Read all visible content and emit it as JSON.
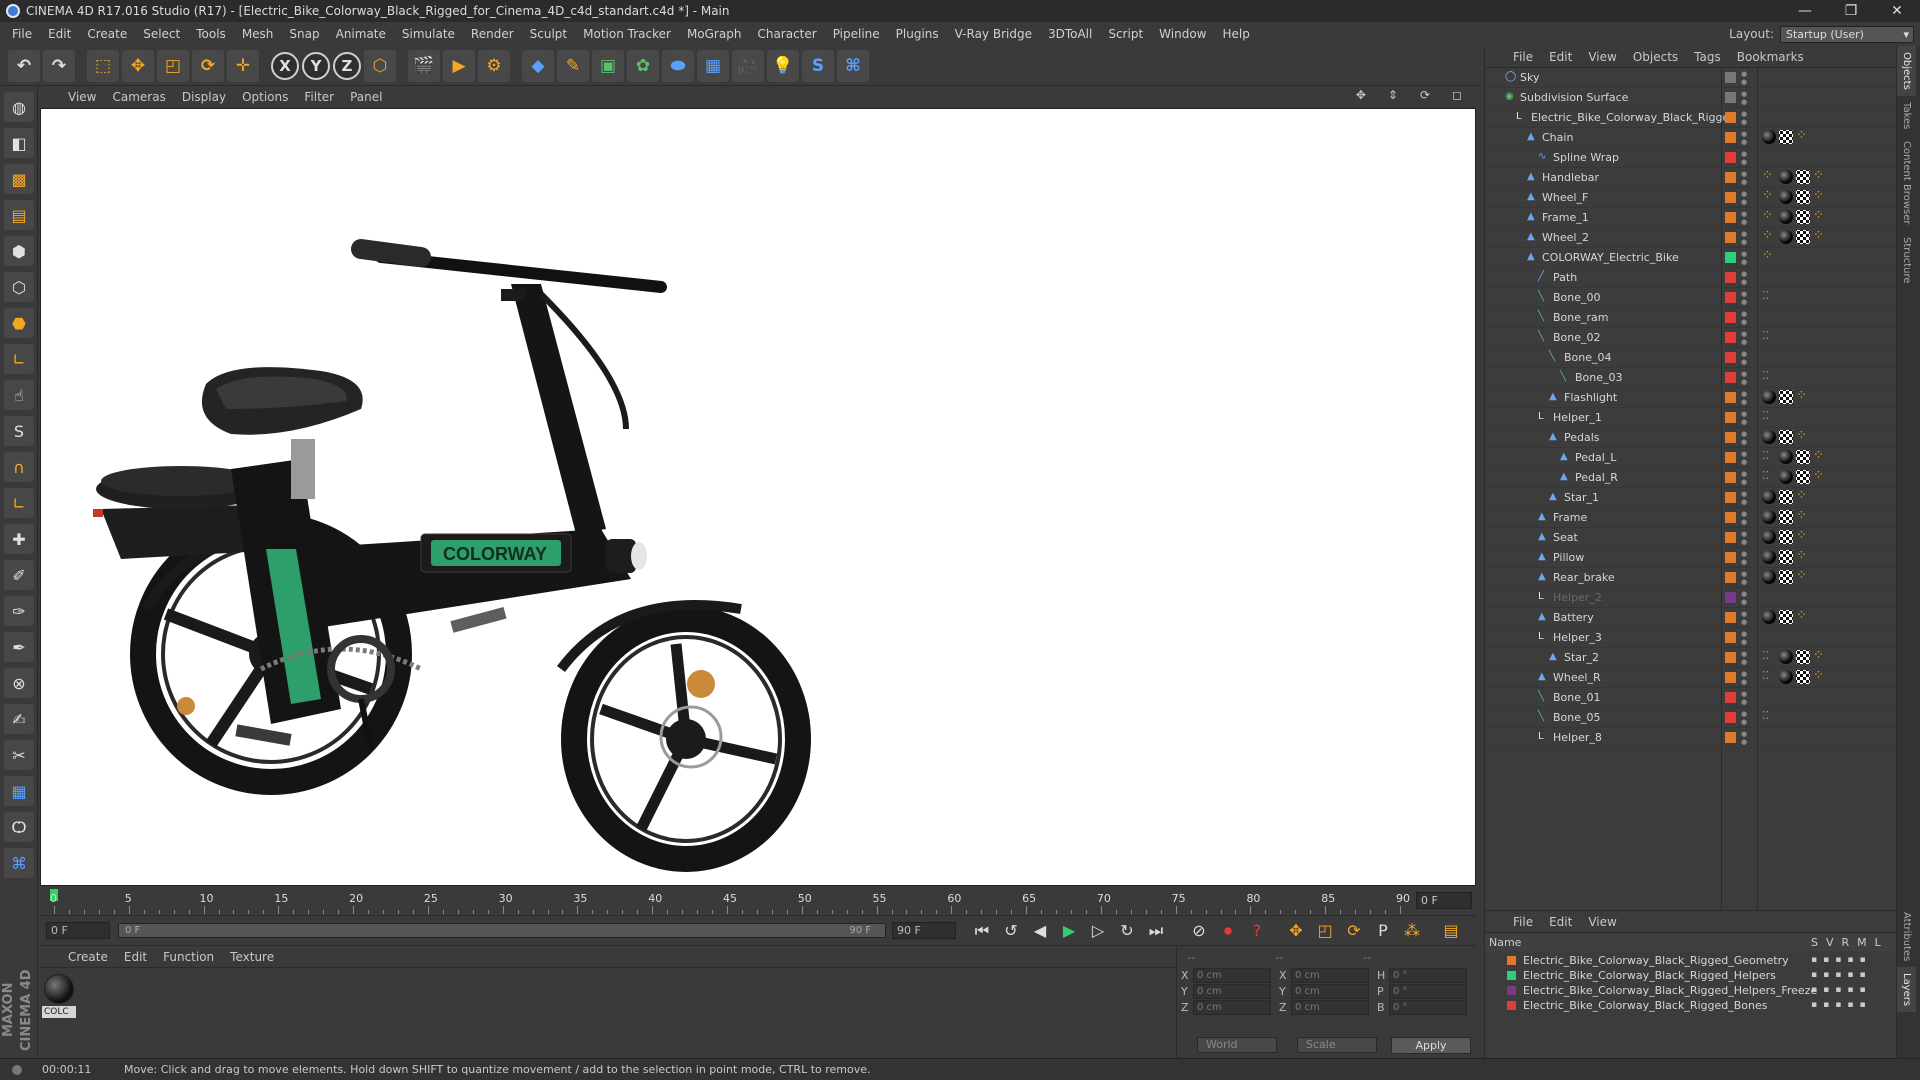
{
  "window": {
    "title": "CINEMA 4D R17.016 Studio (R17) - [Electric_Bike_Colorway_Black_Rigged_for_Cinema_4D_c4d_standart.c4d *] - Main",
    "controls": [
      "—",
      "❐",
      "✕"
    ]
  },
  "menubar": [
    "File",
    "Edit",
    "Create",
    "Select",
    "Tools",
    "Mesh",
    "Snap",
    "Animate",
    "Simulate",
    "Render",
    "Sculpt",
    "Motion Tracker",
    "MoGraph",
    "Character",
    "Pipeline",
    "Plugins",
    "V-Ray Bridge",
    "3DToAll",
    "Script",
    "Window",
    "Help"
  ],
  "layout": {
    "label": "Layout:",
    "value": "Startup (User)"
  },
  "viewport": {
    "menu": [
      "View",
      "Cameras",
      "Display",
      "Options",
      "Filter",
      "Panel"
    ],
    "nav_icons": [
      "✥",
      "⇕",
      "⟳",
      "◻"
    ],
    "logo_text": "COLORWAY"
  },
  "timeline": {
    "ticks": [
      "0",
      "5",
      "10",
      "15",
      "20",
      "25",
      "30",
      "35",
      "40",
      "45",
      "50",
      "55",
      "60",
      "65",
      "70",
      "75",
      "80",
      "85",
      "90"
    ],
    "end_frame": "0 F"
  },
  "transport": {
    "current_frame": "0 F",
    "range_start": "0 F",
    "range_end": "90 F",
    "max_frame": "90 F"
  },
  "material_manager": {
    "menu": [
      "Create",
      "Edit",
      "Function",
      "Texture"
    ],
    "material_label": "COLC"
  },
  "coordinates": {
    "rows": [
      {
        "a": "X",
        "av": "0 cm",
        "b": "X",
        "bv": "0 cm",
        "c": "H",
        "cv": "0 °"
      },
      {
        "a": "Y",
        "av": "0 cm",
        "b": "Y",
        "bv": "0 cm",
        "c": "P",
        "cv": "0 °"
      },
      {
        "a": "Z",
        "av": "0 cm",
        "b": "Z",
        "bv": "0 cm",
        "c": "B",
        "cv": "0 °"
      }
    ],
    "top_labels": [
      "--",
      "--",
      "--"
    ],
    "mode": "World",
    "scale_mode": "Scale",
    "apply": "Apply"
  },
  "object_manager": {
    "menu": [
      "File",
      "Edit",
      "View",
      "Objects",
      "Tags",
      "Bookmarks"
    ],
    "objects": [
      {
        "name": "Sky",
        "indent": 0,
        "icon": "sky-icon",
        "layer": "#777777",
        "tags": []
      },
      {
        "name": "Subdivision Surface",
        "indent": 0,
        "icon": "subdivision-icon",
        "layer": "#777777",
        "tags": []
      },
      {
        "name": "Electric_Bike_Colorway_Black_Rigged",
        "indent": 1,
        "icon": "null-icon",
        "layer": "#e07a2a",
        "tags": []
      },
      {
        "name": "Chain",
        "indent": 2,
        "icon": "polygon-icon",
        "layer": "#e07a2a",
        "tags": [
          "mat",
          "chk",
          "orn"
        ]
      },
      {
        "name": "Spline Wrap",
        "indent": 3,
        "icon": "deformer-icon",
        "layer": "#e33a3a",
        "tags": []
      },
      {
        "name": "Handlebar",
        "indent": 2,
        "icon": "polygon-icon",
        "layer": "#e07a2a",
        "tags": [
          "orn",
          "mat",
          "chk",
          "orn"
        ]
      },
      {
        "name": "Wheel_F",
        "indent": 2,
        "icon": "polygon-icon",
        "layer": "#e07a2a",
        "tags": [
          "orn",
          "mat",
          "chk",
          "orn"
        ]
      },
      {
        "name": "Frame_1",
        "indent": 2,
        "icon": "polygon-icon",
        "layer": "#e07a2a",
        "tags": [
          "orn",
          "mat",
          "chk",
          "orn"
        ]
      },
      {
        "name": "Wheel_2",
        "indent": 2,
        "icon": "polygon-icon",
        "layer": "#e07a2a",
        "tags": [
          "orn",
          "mat",
          "chk",
          "orn"
        ]
      },
      {
        "name": "COLORWAY_Electric_Bike",
        "indent": 2,
        "icon": "polygon-icon",
        "layer": "#2fcf7a",
        "tags": [
          "orn"
        ]
      },
      {
        "name": "Path",
        "indent": 3,
        "icon": "spline-icon",
        "layer": "#e33a3a",
        "tags": []
      },
      {
        "name": "Bone_00",
        "indent": 3,
        "icon": "bone-icon",
        "layer": "#e33a3a",
        "tags": [
          "blu"
        ]
      },
      {
        "name": "Bone_ram",
        "indent": 3,
        "icon": "bone-icon",
        "layer": "#e33a3a",
        "tags": []
      },
      {
        "name": "Bone_02",
        "indent": 3,
        "icon": "bone-icon",
        "layer": "#e33a3a",
        "tags": [
          "blu"
        ]
      },
      {
        "name": "Bone_04",
        "indent": 4,
        "icon": "bone-icon",
        "layer": "#e33a3a",
        "tags": []
      },
      {
        "name": "Bone_03",
        "indent": 5,
        "icon": "bone-icon",
        "layer": "#e33a3a",
        "tags": [
          "blu"
        ]
      },
      {
        "name": "Flashlight",
        "indent": 4,
        "icon": "polygon-icon",
        "layer": "#e07a2a",
        "tags": [
          "mat",
          "chk",
          "orn"
        ]
      },
      {
        "name": "Helper_1",
        "indent": 3,
        "icon": "null-icon",
        "layer": "#e07a2a",
        "tags": [
          "blu"
        ]
      },
      {
        "name": "Pedals",
        "indent": 4,
        "icon": "polygon-icon",
        "layer": "#e07a2a",
        "tags": [
          "mat",
          "chk",
          "orn"
        ]
      },
      {
        "name": "Pedal_L",
        "indent": 5,
        "icon": "polygon-icon",
        "layer": "#e07a2a",
        "tags": [
          "blu",
          "mat",
          "chk",
          "orn"
        ]
      },
      {
        "name": "Pedal_R",
        "indent": 5,
        "icon": "polygon-icon",
        "layer": "#e07a2a",
        "tags": [
          "blu",
          "mat",
          "chk",
          "orn"
        ]
      },
      {
        "name": "Star_1",
        "indent": 4,
        "icon": "polygon-icon",
        "layer": "#e07a2a",
        "tags": [
          "mat",
          "chk",
          "orn"
        ]
      },
      {
        "name": "Frame",
        "indent": 3,
        "icon": "polygon-icon",
        "layer": "#e07a2a",
        "tags": [
          "mat",
          "chk",
          "orn"
        ]
      },
      {
        "name": "Seat",
        "indent": 3,
        "icon": "polygon-icon",
        "layer": "#e07a2a",
        "tags": [
          "mat",
          "chk",
          "orn"
        ]
      },
      {
        "name": "Pillow",
        "indent": 3,
        "icon": "polygon-icon",
        "layer": "#e07a2a",
        "tags": [
          "mat",
          "chk",
          "orn"
        ]
      },
      {
        "name": "Rear_brake",
        "indent": 3,
        "icon": "polygon-icon",
        "layer": "#e07a2a",
        "tags": [
          "mat",
          "chk",
          "orn"
        ]
      },
      {
        "name": "Helper_2",
        "indent": 3,
        "icon": "null-icon",
        "layer": "#7a3a8a",
        "tags": [],
        "dim": true
      },
      {
        "name": "Battery",
        "indent": 3,
        "icon": "polygon-icon",
        "layer": "#e07a2a",
        "tags": [
          "mat",
          "chk",
          "orn"
        ]
      },
      {
        "name": "Helper_3",
        "indent": 3,
        "icon": "null-icon",
        "layer": "#e07a2a",
        "tags": []
      },
      {
        "name": "Star_2",
        "indent": 4,
        "icon": "polygon-icon",
        "layer": "#e07a2a",
        "tags": [
          "blu",
          "mat",
          "chk",
          "orn"
        ]
      },
      {
        "name": "Wheel_R",
        "indent": 3,
        "icon": "polygon-icon",
        "layer": "#e07a2a",
        "tags": [
          "blu",
          "mat",
          "chk",
          "orn"
        ]
      },
      {
        "name": "Bone_01",
        "indent": 3,
        "icon": "bone-icon",
        "layer": "#e33a3a",
        "tags": []
      },
      {
        "name": "Bone_05",
        "indent": 3,
        "icon": "bone-icon",
        "layer": "#e33a3a",
        "tags": [
          "blu"
        ]
      },
      {
        "name": "Helper_8",
        "indent": 3,
        "icon": "null-icon",
        "layer": "#e07a2a",
        "tags": []
      }
    ]
  },
  "layer_manager": {
    "menu": [
      "File",
      "Edit",
      "View"
    ],
    "header": {
      "name": "Name",
      "flags": [
        "S",
        "V",
        "R",
        "M",
        "L"
      ]
    },
    "layers": [
      {
        "name": "Electric_Bike_Colorway_Black_Rigged_Geometry",
        "color": "#e07a2a"
      },
      {
        "name": "Electric_Bike_Colorway_Black_Rigged_Helpers",
        "color": "#2fcf7a"
      },
      {
        "name": "Electric_Bike_Colorway_Black_Rigged_Helpers_Freeze",
        "color": "#7a3a8a"
      },
      {
        "name": "Electric_Bike_Colorway_Black_Rigged_Bones",
        "color": "#e33a3a"
      }
    ]
  },
  "side_tabs": [
    "Objects",
    "Takes",
    "Content Browser",
    "Structure"
  ],
  "side_tabs_lower": [
    "Attributes",
    "Layers"
  ],
  "status": {
    "time": "00:00:11",
    "message": "Move: Click and drag to move elements. Hold down SHIFT to quantize movement / add to the selection in point mode, CTRL to remove."
  }
}
